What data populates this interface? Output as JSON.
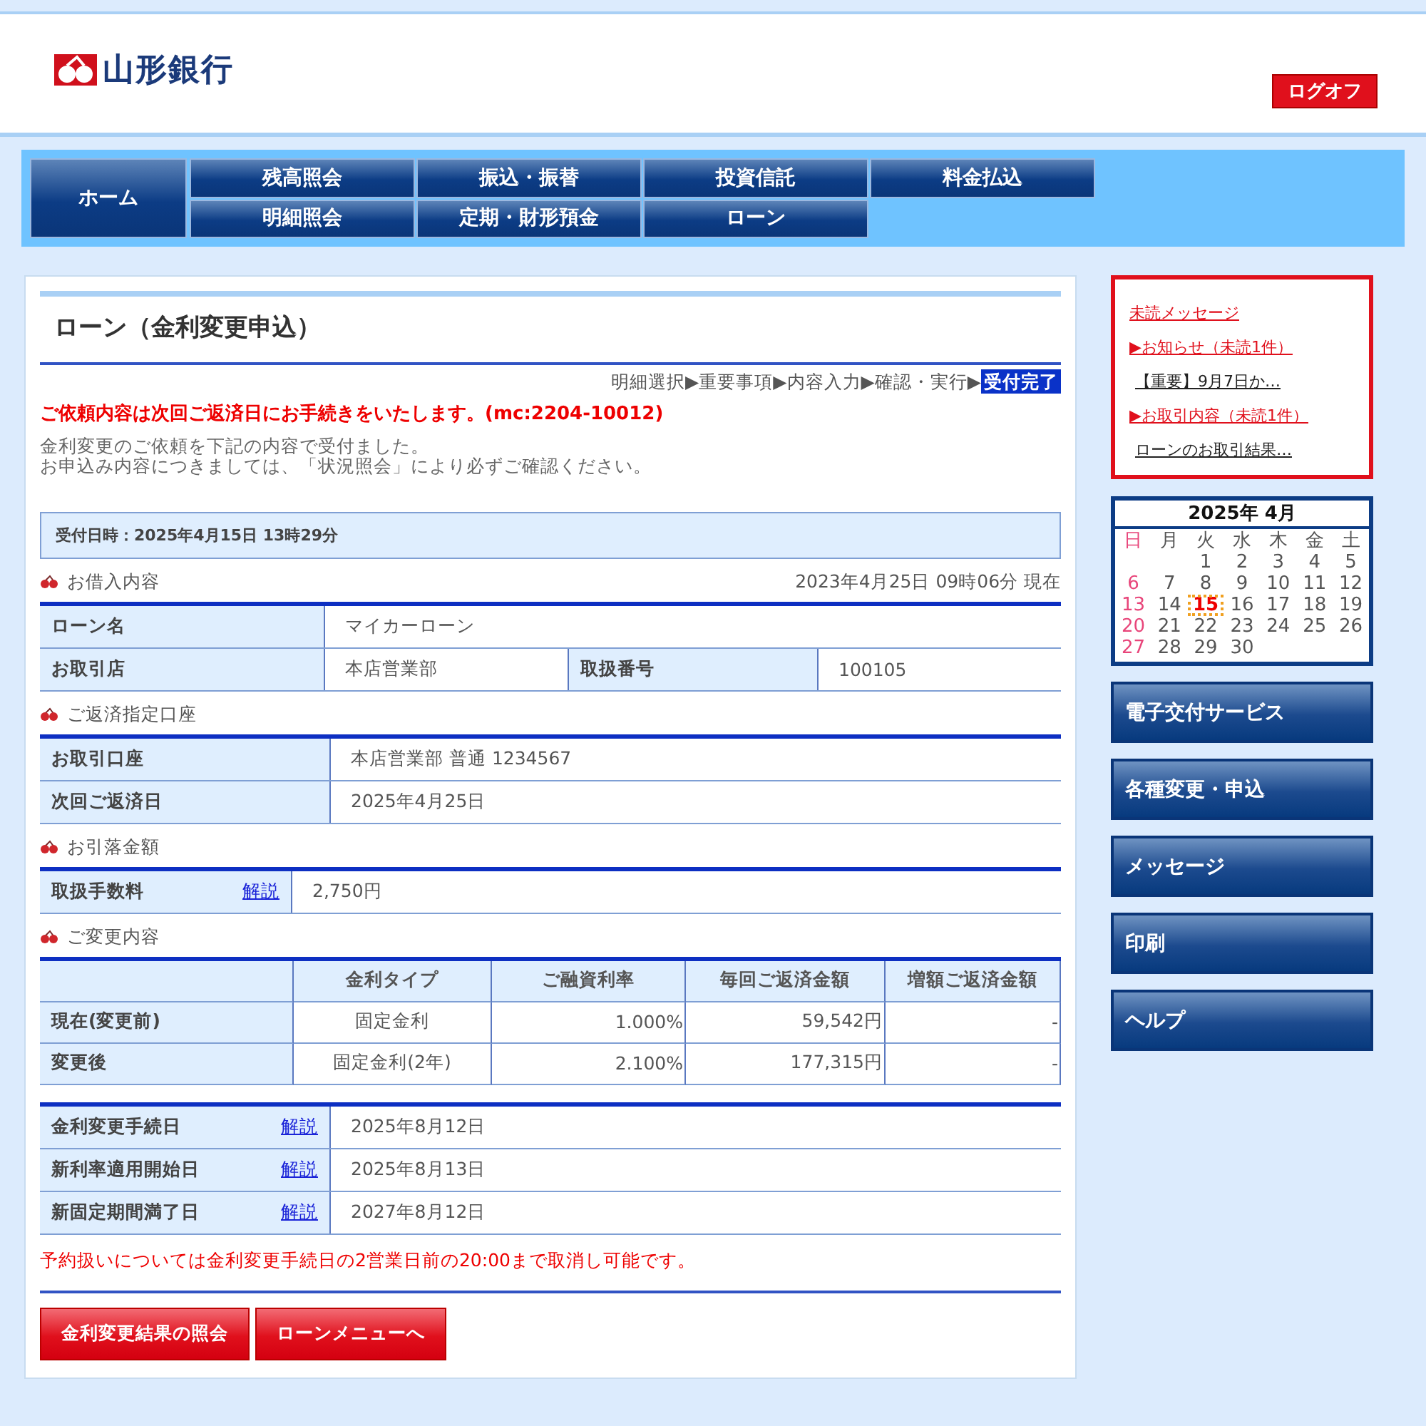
{
  "header": {
    "logo_text": "山形銀行",
    "logoff": "ログオフ"
  },
  "nav": {
    "home": "ホーム",
    "items": [
      {
        "label": "残高照会"
      },
      {
        "label": "振込・振替"
      },
      {
        "label": "投資信託"
      },
      {
        "label": "料金払込"
      },
      {
        "label": "明細照会"
      },
      {
        "label": "定期・財形預金"
      },
      {
        "label": "ローン"
      }
    ]
  },
  "page": {
    "title": "ローン（金利変更申込）",
    "step_separator": "▶",
    "steps": [
      {
        "label": "明細選択",
        "selected": false
      },
      {
        "label": "重要事項",
        "selected": false
      },
      {
        "label": "内容入力",
        "selected": false
      },
      {
        "label": "確認・実行",
        "selected": false
      },
      {
        "label": "受付完了",
        "selected": true
      }
    ],
    "notice": "ご依頼内容は次回ご返済日にお手続きをいたします。(mc:2204-10012)",
    "message_lines": [
      "金利変更のご依頼を下記の内容で受付ました。",
      "お申込み内容につきましては、「状況照会」により必ずご確認ください。"
    ],
    "receipt": "受付日時：2025年4月15日 13時29分"
  },
  "loan": {
    "heading": "お借入内容",
    "timestamp": "2023年4月25日 09時06分 現在",
    "rows": [
      {
        "cells": [
          {
            "kind": "label",
            "text": "ローン名"
          },
          {
            "kind": "value",
            "text": "マイカーローン"
          }
        ]
      },
      {
        "cells": [
          {
            "kind": "label",
            "text": "お取引店"
          },
          {
            "kind": "value",
            "text": "本店営業部"
          },
          {
            "kind": "label",
            "text": "取扱番号"
          },
          {
            "kind": "value",
            "text": "100105"
          }
        ]
      }
    ]
  },
  "account": {
    "heading": "ご返済指定口座",
    "rows": [
      {
        "label": "お取引口座",
        "value": "本店営業部 普通 1234567"
      },
      {
        "label": "次回ご返済日",
        "value": "2025年4月25日"
      }
    ]
  },
  "debit": {
    "heading": "お引落金額",
    "rows": [
      {
        "label": "取扱手数料",
        "help": "解説",
        "value": "2,750円"
      }
    ]
  },
  "change": {
    "heading": "ご変更内容",
    "columns": [
      "金利タイプ",
      "ご融資利率",
      "毎回ご返済金額",
      "増額ご返済金額"
    ],
    "rows": [
      {
        "label": "現在(変更前)",
        "cells": [
          "固定金利",
          "1.000%",
          "59,542円",
          "-"
        ]
      },
      {
        "label": "変更後",
        "cells": [
          "固定金利(2年)",
          "2.100%",
          "177,315円",
          "-"
        ]
      }
    ]
  },
  "dates": {
    "rows": [
      {
        "label": "金利変更手続日",
        "help": "解説",
        "value": "2025年8月12日"
      },
      {
        "label": "新利率適用開始日",
        "help": "解説",
        "value": "2025年8月13日"
      },
      {
        "label": "新固定期間満了日",
        "help": "解説",
        "value": "2027年8月12日"
      }
    ]
  },
  "cancel_note": "予約扱いについては金利変更手続日の2営業日前の20:00まで取消し可能です。",
  "buttons": [
    "金利変更結果の照会",
    "ローンメニューへ"
  ],
  "messages": {
    "title": "未読メッセージ",
    "items": [
      {
        "kind": "category",
        "text": "▶お知らせ（未読1件）"
      },
      {
        "kind": "link",
        "text": "【重要】9月7日か…"
      },
      {
        "kind": "category",
        "text": "▶お取引内容（未読1件）"
      },
      {
        "kind": "link",
        "text": "ローンのお取引結果…"
      }
    ]
  },
  "calendar": {
    "title": "2025年 4月",
    "weekdays": [
      "日",
      "月",
      "火",
      "水",
      "木",
      "金",
      "土"
    ],
    "weeks": [
      [
        {
          "kind": "blank"
        },
        {
          "kind": "blank"
        },
        {
          "kind": "day",
          "day": "1",
          "selected": false
        },
        {
          "kind": "day",
          "day": "2",
          "selected": false
        },
        {
          "kind": "day",
          "day": "3",
          "selected": false
        },
        {
          "kind": "day",
          "day": "4",
          "selected": false
        },
        {
          "kind": "day",
          "day": "5",
          "selected": false
        }
      ],
      [
        {
          "kind": "day",
          "day": "6",
          "selected": false
        },
        {
          "kind": "day",
          "day": "7",
          "selected": false
        },
        {
          "kind": "day",
          "day": "8",
          "selected": false
        },
        {
          "kind": "day",
          "day": "9",
          "selected": false
        },
        {
          "kind": "day",
          "day": "10",
          "selected": false
        },
        {
          "kind": "day",
          "day": "11",
          "selected": false
        },
        {
          "kind": "day",
          "day": "12",
          "selected": false
        }
      ],
      [
        {
          "kind": "day",
          "day": "13",
          "selected": false
        },
        {
          "kind": "day",
          "day": "14",
          "selected": false
        },
        {
          "kind": "day",
          "day": "15",
          "selected": true
        },
        {
          "kind": "day",
          "day": "16",
          "selected": false
        },
        {
          "kind": "day",
          "day": "17",
          "selected": false
        },
        {
          "kind": "day",
          "day": "18",
          "selected": false
        },
        {
          "kind": "day",
          "day": "19",
          "selected": false
        }
      ],
      [
        {
          "kind": "day",
          "day": "20",
          "selected": false
        },
        {
          "kind": "day",
          "day": "21",
          "selected": false
        },
        {
          "kind": "day",
          "day": "22",
          "selected": false
        },
        {
          "kind": "day",
          "day": "23",
          "selected": false
        },
        {
          "kind": "day",
          "day": "24",
          "selected": false
        },
        {
          "kind": "day",
          "day": "25",
          "selected": false
        },
        {
          "kind": "day",
          "day": "26",
          "selected": false
        }
      ],
      [
        {
          "kind": "day",
          "day": "27",
          "selected": false
        },
        {
          "kind": "day",
          "day": "28",
          "selected": false
        },
        {
          "kind": "day",
          "day": "29",
          "selected": false
        },
        {
          "kind": "day",
          "day": "30",
          "selected": false
        }
      ]
    ]
  },
  "side_buttons": [
    "電子交付サービス",
    "各種変更・申込",
    "メッセージ",
    "印刷",
    "ヘルプ"
  ]
}
